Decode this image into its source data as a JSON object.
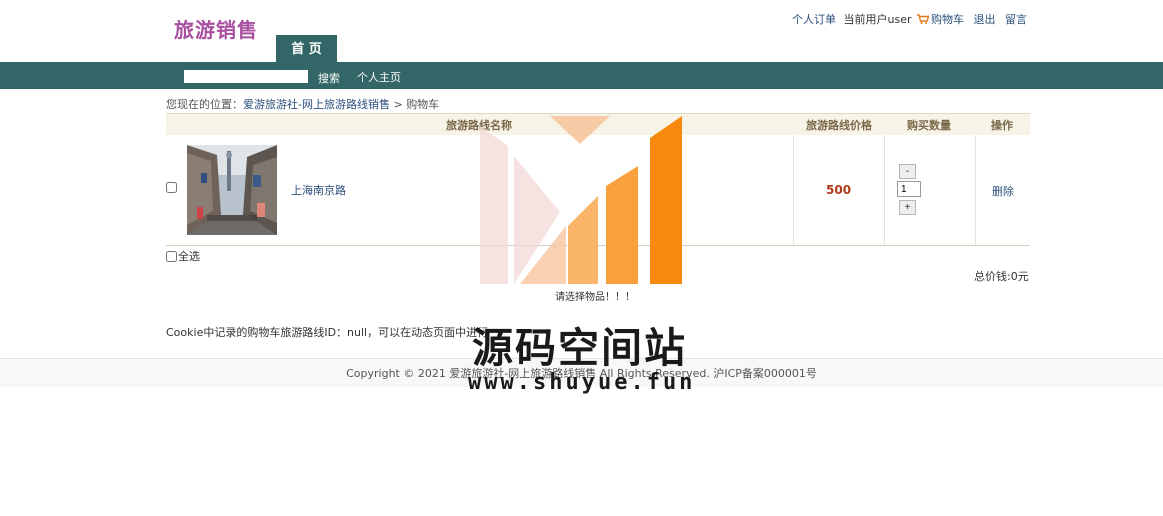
{
  "header": {
    "logo": "旅游销售",
    "links": {
      "orders": "个人订单",
      "current_user": "当前用户user",
      "cart": "购物车",
      "logout": "退出",
      "message": "留言"
    },
    "home_tab": "首 页"
  },
  "nav": {
    "search_value": "",
    "search_label": "搜索",
    "home_label": "个人主页"
  },
  "breadcrumb": {
    "prefix": "您现在的位置：",
    "site": "爱游旅游社-网上旅游路线销售",
    "sep": " > ",
    "current": "购物车"
  },
  "table": {
    "headers": [
      "旅游路线名称",
      "旅游路线价格",
      "购买数量",
      "操作"
    ],
    "rows": [
      {
        "name": "上海南京路",
        "price": "500",
        "quantity": "1",
        "minus": "-",
        "plus": "+",
        "action": "删除"
      }
    ]
  },
  "select_all_label": "全选",
  "total": "总价钱:0元",
  "message": "请选择物品！！！",
  "cookie_note": "Cookie中记录的购物车旅游路线ID：null，可以在动态页面中进行",
  "footer": {
    "copyright": "Copyright © 2021 爱游旅游社-网上旅游路线销售 All Rights Reserved. 沪ICP备案000001号"
  },
  "watermark": {
    "text": "源码空间站",
    "url": "www.shuyue.fun"
  },
  "colors": {
    "nav": "#336666",
    "logo": "#a94fa0",
    "price": "#b03a1a",
    "link": "#2b4f7a",
    "watermark_orange": "#f7890f"
  },
  "icons": {
    "cart": "cart-icon",
    "watermark_logo": "watermark-logo-icon"
  }
}
